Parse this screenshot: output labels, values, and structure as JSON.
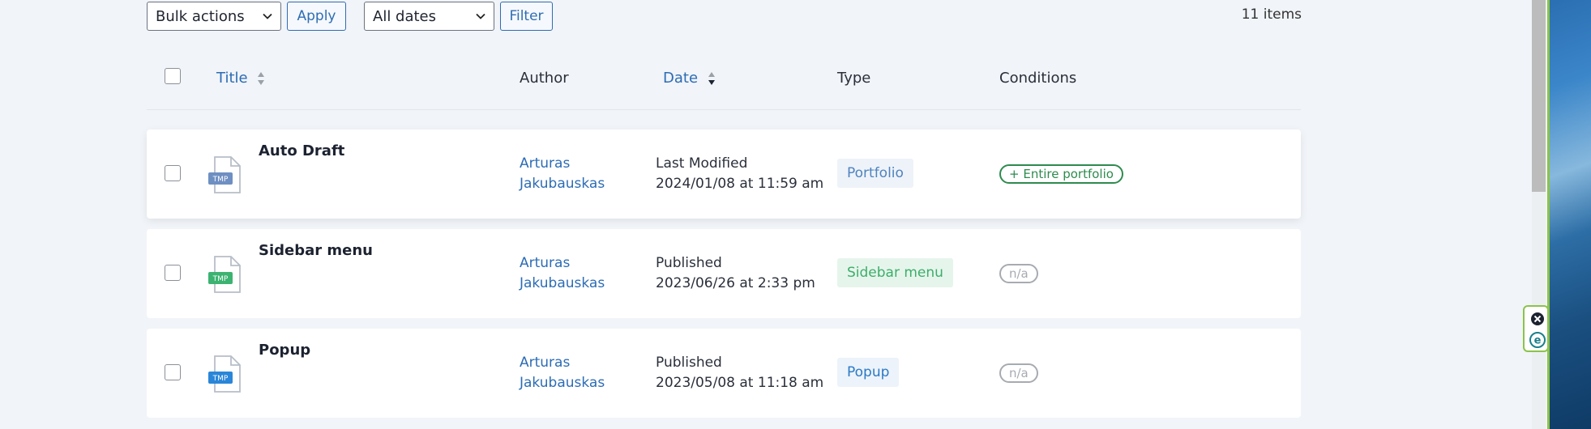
{
  "toolbar": {
    "bulk_actions": "Bulk actions",
    "apply": "Apply",
    "dates": "All dates",
    "filter": "Filter",
    "items_count": "11 items"
  },
  "columns": {
    "title": "Title",
    "author": "Author",
    "date": "Date",
    "type": "Type",
    "conditions": "Conditions"
  },
  "rows": [
    {
      "badge": "TMP",
      "badge_color": "#6e8fc2",
      "title": "Auto Draft",
      "author_first": "Arturas",
      "author_last": "Jakubauskas",
      "date_status": "Last Modified",
      "date_value": "2024/01/08 at 11:59 am",
      "type": "Portfolio",
      "type_color": "#4f83bf",
      "type_bg": "#eef3f9",
      "condition": "+ Entire portfolio",
      "condition_color": "#2e8b4e"
    },
    {
      "badge": "TMP",
      "badge_color": "#3cb371",
      "title": "Sidebar menu",
      "author_first": "Arturas",
      "author_last": "Jakubauskas",
      "date_status": "Published",
      "date_value": "2023/06/26 at 2:33 pm",
      "type": "Sidebar menu",
      "type_color": "#3cae6a",
      "type_bg": "#e6f5ec",
      "condition": "n/a",
      "condition_color": "#a7abb1"
    },
    {
      "badge": "TMP",
      "badge_color": "#2a86d8",
      "title": "Popup",
      "author_first": "Arturas",
      "author_last": "Jakubauskas",
      "date_status": "Published",
      "date_value": "2023/05/08 at 11:18 am",
      "type": "Popup",
      "type_color": "#2a79c6",
      "type_bg": "#ecf3fa",
      "condition": "n/a",
      "condition_color": "#a7abb1"
    }
  ]
}
